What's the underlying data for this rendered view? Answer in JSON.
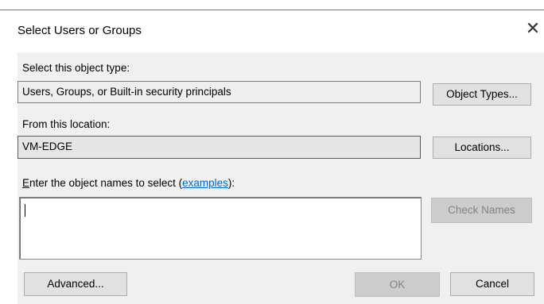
{
  "dialog": {
    "title": "Select Users or Groups",
    "close_glyph": "✕"
  },
  "object_type": {
    "label": "Select this object type:",
    "value": "Users, Groups, or Built-in security principals",
    "button": "Object Types..."
  },
  "location": {
    "label": "From this location:",
    "value": "VM-EDGE",
    "button": "Locations..."
  },
  "names": {
    "label_accel": "E",
    "label_rest": "nter the object names to select (",
    "link": "examples",
    "label_end": "):",
    "value": "",
    "check_button": "Check Names"
  },
  "footer": {
    "advanced": "Advanced...",
    "ok": "OK",
    "cancel": "Cancel"
  }
}
